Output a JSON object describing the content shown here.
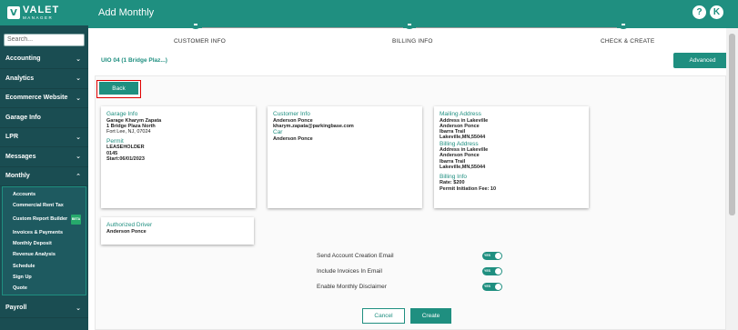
{
  "app": {
    "logo_main": "VALET",
    "logo_sub": "MANAGER",
    "logo_badge": "V"
  },
  "sidebar": {
    "search_placeholder": "Search...",
    "items_top": [
      {
        "label": "Accounting",
        "chevron": "⌄"
      },
      {
        "label": "Analytics",
        "chevron": "⌄"
      },
      {
        "label": "Ecommerce Website",
        "chevron": "⌄"
      },
      {
        "label": "Garage Info",
        "chevron": ""
      },
      {
        "label": "LPR",
        "chevron": "⌄"
      },
      {
        "label": "Messages",
        "chevron": "⌄"
      },
      {
        "label": "Monthly",
        "chevron": "⌃"
      }
    ],
    "sub_items": [
      "Accounts",
      "Commercial Rent Tax",
      "Custom Report Builder",
      "Invoices & Payments",
      "Monthly Deposit",
      "Revenue Analysis",
      "Schedule",
      "Sign Up",
      "Quote"
    ],
    "beta_badge": "BETA",
    "items_bottom": [
      {
        "label": "Payroll",
        "chevron": "⌄"
      }
    ]
  },
  "header": {
    "title": "Add Monthly",
    "help_label": "?",
    "avatar_label": "K"
  },
  "stepper": {
    "steps": [
      "CUSTOMER INFO",
      "BILLING INFO",
      "CHECK & CREATE"
    ]
  },
  "garage_selector": "UIO 04 (1 Bridge Plaz...)",
  "buttons": {
    "advanced": "Advanced",
    "back": "Back",
    "cancel": "Cancel",
    "create": "Create"
  },
  "cards": {
    "garage": {
      "title": "Garage Info",
      "name": "Garage Kharym Zapata",
      "address1": "1 Bridge Plaza North",
      "address2": "Fort Lee, NJ, 07024",
      "permit_title": "Permit",
      "permit_type": "LEASEHOLDER",
      "permit_number": "0145",
      "permit_start": "Start:06/01/2023"
    },
    "customer": {
      "title": "Customer Info",
      "name": "Anderson Ponce",
      "email": "kharym.zapata@parkingbase.com",
      "car_title": "Car",
      "car_value": "Anderson Ponce"
    },
    "mailing": {
      "title": "Mailing Address",
      "lines": [
        "Address in Lakeville",
        "Anderson Ponce",
        "Ibarra Trail",
        "Lakeville,MN,55044"
      ],
      "billing_title": "Billing Address",
      "billing_lines": [
        "Address in Lakeville",
        "Anderson Ponce",
        "Ibarra Trail",
        "Lakeville,MN,55044"
      ],
      "billing_info_title": "Billing Info",
      "rate": "Rate: $200",
      "permit_fee": "Permit Initiation Fee: 10"
    },
    "driver": {
      "title": "Authorized Driver",
      "name": "Anderson Ponce"
    }
  },
  "toggles": [
    {
      "label": "Send Account Creation Email",
      "state": "YES"
    },
    {
      "label": "Include Invoices In Email",
      "state": "YES"
    },
    {
      "label": "Enable Monthly Disclaimer",
      "state": "YES"
    }
  ],
  "colors": {
    "brand": "#1f8f80",
    "sidebar": "#1a4d52",
    "highlight": "#e00000"
  }
}
